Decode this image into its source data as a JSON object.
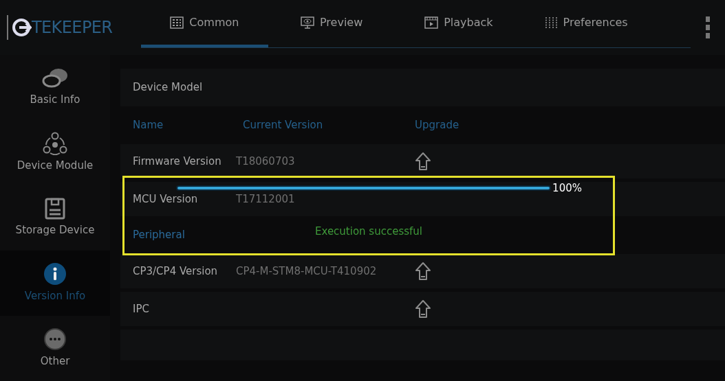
{
  "logo": {
    "text": "TEKEEPER"
  },
  "tabs": [
    {
      "label": "Common",
      "selected": true
    },
    {
      "label": "Preview",
      "selected": false
    },
    {
      "label": "Playback",
      "selected": false
    },
    {
      "label": "Preferences",
      "selected": false
    }
  ],
  "sidebar": {
    "items": [
      {
        "label": "Basic Info",
        "selected": false
      },
      {
        "label": "Device Module",
        "selected": false
      },
      {
        "label": "Storage Device",
        "selected": false
      },
      {
        "label": "Version Info",
        "selected": true
      },
      {
        "label": "Other",
        "selected": false
      }
    ]
  },
  "device_model": {
    "label": "Device Model"
  },
  "table": {
    "columns": [
      "Name",
      "Current Version",
      "Upgrade"
    ],
    "rows": [
      {
        "kind": "row",
        "name": "Firmware Version",
        "version": "T18060703",
        "upgrade": true
      },
      {
        "kind": "row",
        "name": "MCU Version",
        "version": "T17112001",
        "upgrade": false
      },
      {
        "kind": "section",
        "name": "Peripheral"
      },
      {
        "kind": "row",
        "name": "CP3/CP4 Version",
        "version": "CP4-M-STM8-MCU-T410902",
        "upgrade": true
      },
      {
        "kind": "row",
        "name": "IPC",
        "upgrade": true
      },
      {
        "kind": "empty"
      }
    ]
  },
  "dialog": {
    "progress": {
      "level": 1.0,
      "reading": "100%"
    },
    "message": "Execution successful"
  }
}
